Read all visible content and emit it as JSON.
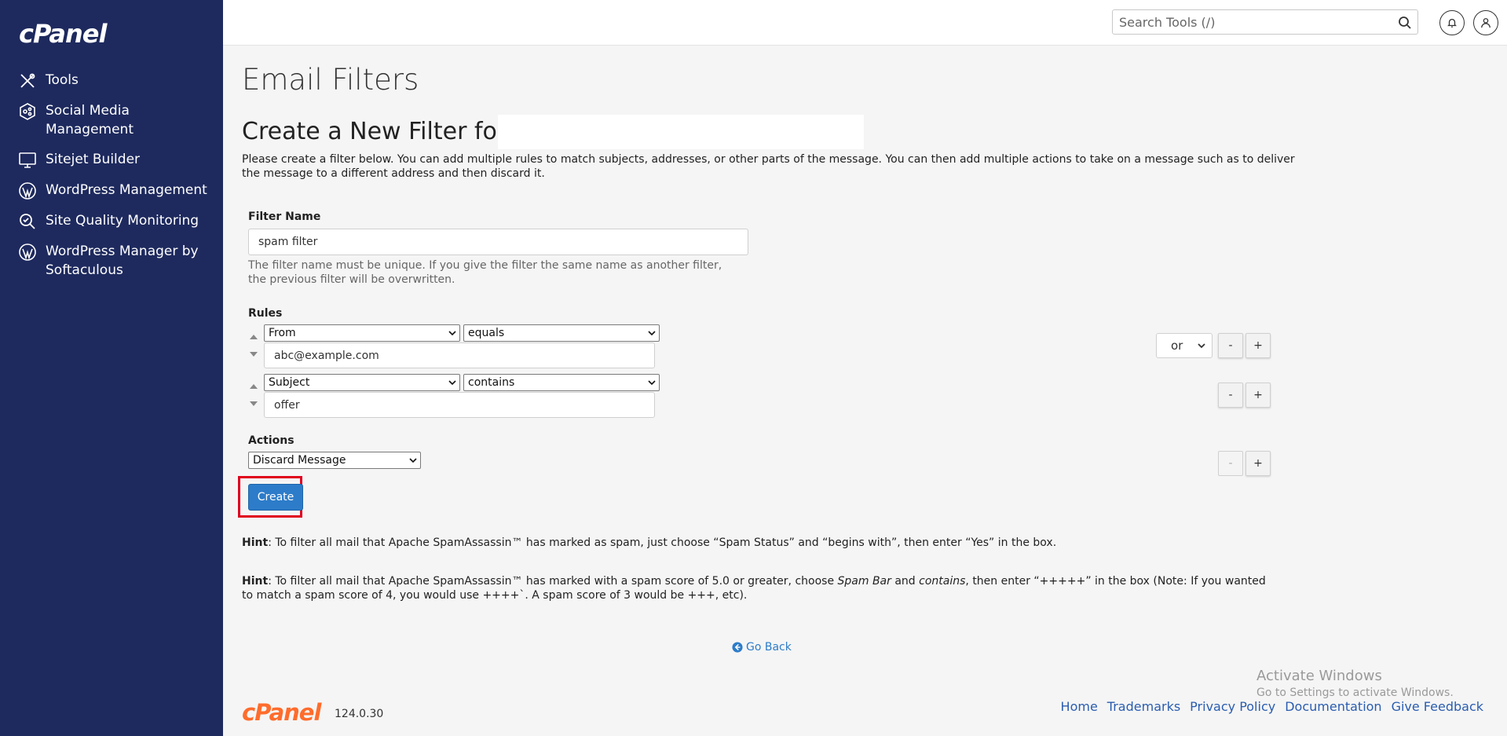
{
  "sidebar": {
    "logo": "cPanel",
    "items": [
      {
        "label": "Tools"
      },
      {
        "label": "Social Media Management"
      },
      {
        "label": "Sitejet Builder"
      },
      {
        "label": "WordPress Management"
      },
      {
        "label": "Site Quality Monitoring"
      },
      {
        "label": "WordPress Manager by Softaculous"
      }
    ]
  },
  "header": {
    "search_placeholder": "Search Tools (/)"
  },
  "page": {
    "title": "Email Filters",
    "subtitle": "Create a New Filter for",
    "description": "Please create a filter below. You can add multiple rules to match subjects, addresses, or other parts of the message. You can then add multiple actions to take on a message such as to deliver the message to a different address and then discard it."
  },
  "form": {
    "filter_name_label": "Filter Name",
    "filter_name_value": "spam filter",
    "filter_name_help": "The filter name must be unique. If you give the filter the same name as another filter, the previous filter will be overwritten.",
    "rules_label": "Rules",
    "rules": [
      {
        "field": "From",
        "operator": "equals",
        "value": "abc@example.com"
      },
      {
        "field": "Subject",
        "operator": "contains",
        "value": "offer"
      }
    ],
    "rule_connector": "or",
    "minus_label": "-",
    "plus_label": "+",
    "actions_label": "Actions",
    "action_value": "Discard Message",
    "create_label": "Create"
  },
  "hints": {
    "hint_word": "Hint",
    "hint1_text": ": To filter all mail that Apache SpamAssassin™ has marked as spam, just choose “Spam Status” and “begins with”, then enter “Yes” in the box.",
    "hint2_part1": ": To filter all mail that Apache SpamAssassin™ has marked with a spam score of 5.0 or greater, choose ",
    "hint2_em1": "Spam Bar",
    "hint2_part2": " and ",
    "hint2_em2": "contains",
    "hint2_part3": ", then enter “+++++” in the box (Note: If you wanted to match a spam score of 4, you would use ++++`. A spam score of 3 would be +++, etc)."
  },
  "go_back": "Go Back",
  "watermark": {
    "line1": "Activate Windows",
    "line2": "Go to Settings to activate Windows."
  },
  "footer": {
    "logo": "cPanel",
    "version": "124.0.30",
    "links": [
      "Home",
      "Trademarks",
      "Privacy Policy",
      "Documentation",
      "Give Feedback"
    ]
  },
  "colors": {
    "sidebar_bg": "#1e2a5e",
    "primary_button": "#2d7cc9",
    "highlight_border": "#e0001b",
    "footer_logo": "#ff6c2c"
  }
}
